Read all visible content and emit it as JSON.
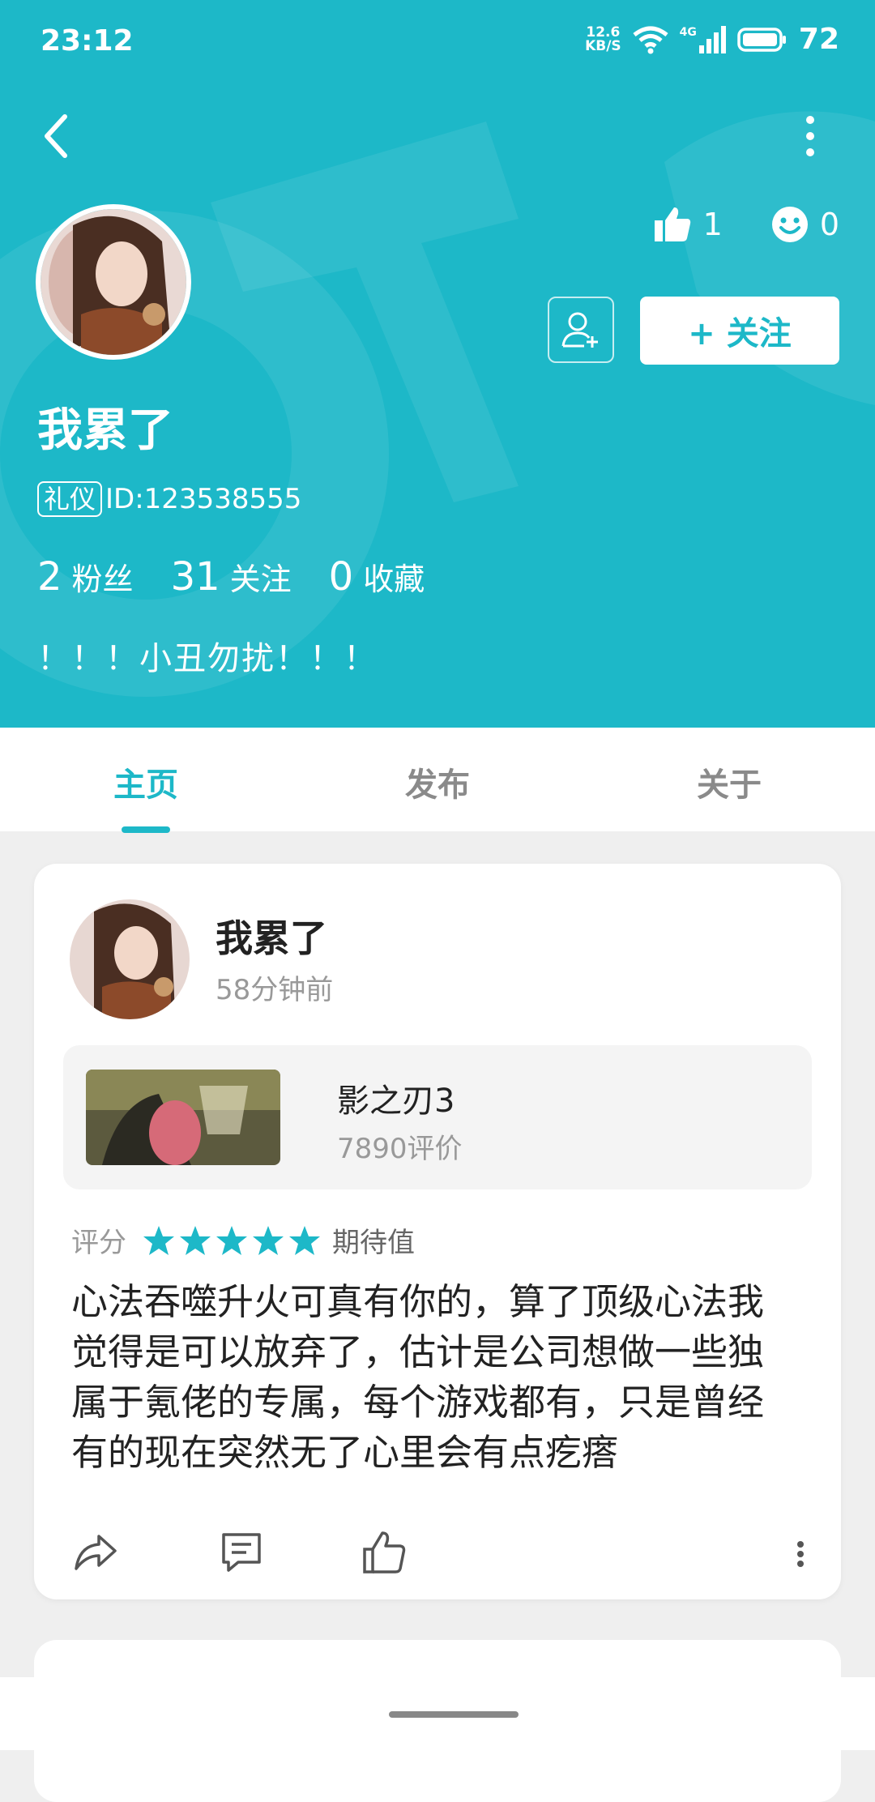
{
  "status": {
    "time": "23:12",
    "speed_value": "12.6",
    "speed_unit": "KB/S",
    "network": "4G",
    "battery": "72"
  },
  "profile": {
    "likes": "1",
    "smiles": "0",
    "follow_label": "+ 关注",
    "name": "我累了",
    "badge": "礼仪",
    "id_text": "ID:123538555",
    "fans_num": "2",
    "fans_label": "粉丝",
    "following_num": "31",
    "following_label": "关注",
    "collect_num": "0",
    "collect_label": "收藏",
    "bio": "！！！小丑勿扰！！！"
  },
  "tabs": [
    "主页",
    "发布",
    "关于"
  ],
  "post": {
    "author": "我累了",
    "time": "58分钟前",
    "game_title": "影之刃3",
    "game_reviews": "7890评价",
    "rating_label": "评分",
    "rating_stars": 5,
    "rating_text": "期待值",
    "body": "心法吞噬升火可真有你的，算了顶级心法我觉得是可以放弃了，估计是公司想做一些独属于氪佬的专属，每个游戏都有，只是曾经有的现在突然无了心里会有点疙瘩"
  },
  "colors": {
    "accent": "#1db8c8",
    "star": "#1db8c8"
  }
}
